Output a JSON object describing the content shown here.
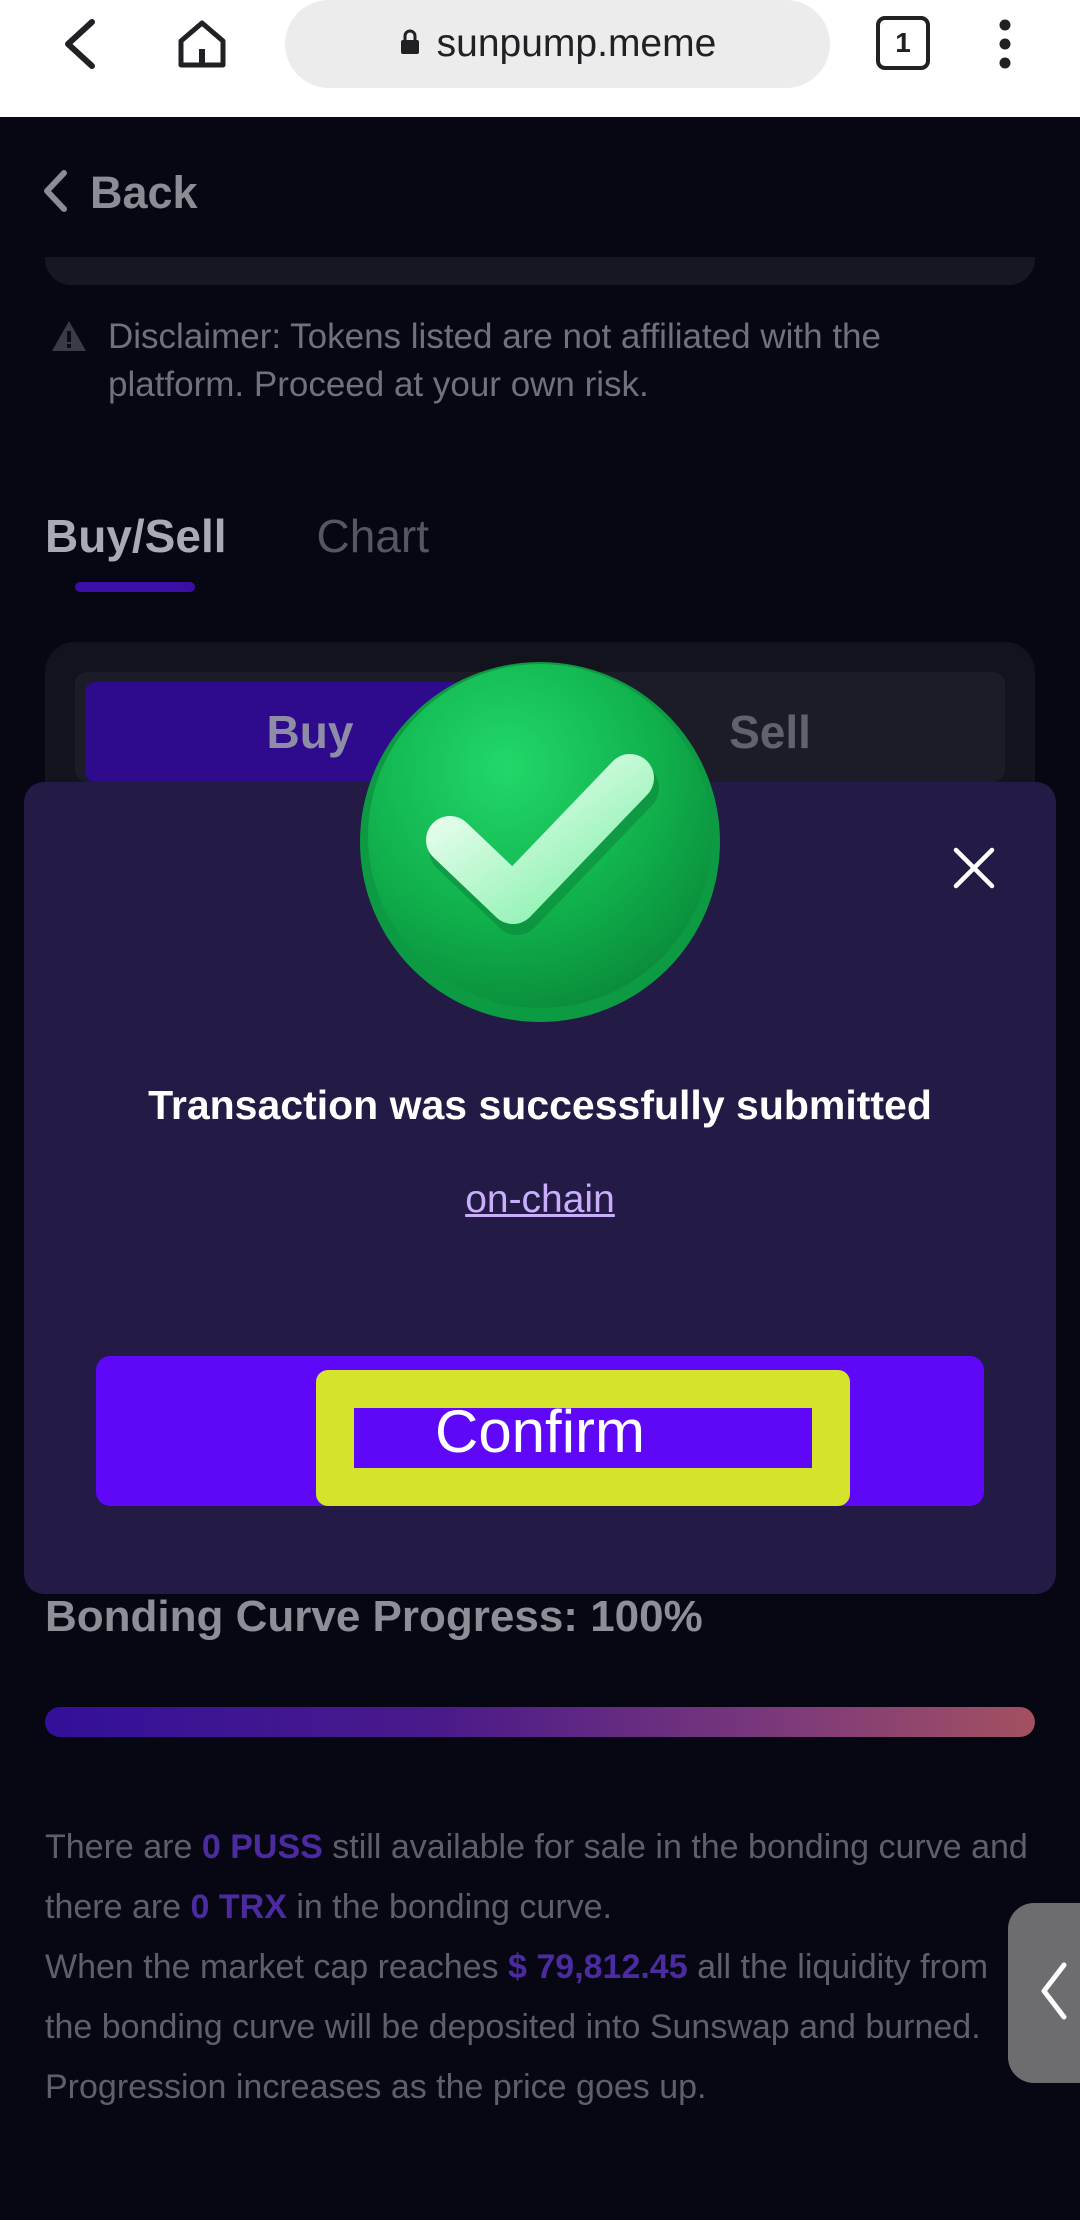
{
  "browser": {
    "url": "sunpump.meme",
    "tab_count": "1",
    "icons": [
      "back-arrow-icon",
      "home-icon",
      "lock-icon",
      "tabs-icon",
      "more-vert-icon"
    ]
  },
  "page": {
    "back_label": "Back",
    "disclaimer": "Disclaimer: Tokens listed are not affiliated with the platform. Proceed at your own risk.",
    "tabs": [
      {
        "label": "Buy/Sell",
        "active": true
      },
      {
        "label": "Chart",
        "active": false
      }
    ],
    "trade": {
      "buy_label": "Buy",
      "sell_label": "Sell"
    },
    "bonding": {
      "title": "Bonding Curve Progress: 100%",
      "progress": 1.0,
      "text_parts": {
        "p1": "There are ",
        "token_amount": "0 PUSS",
        "p2": " still available for sale in the bonding curve and there are ",
        "trx_amount": "0 TRX",
        "p3": " in the bonding curve.",
        "p4": "When the market cap reaches ",
        "market_cap": "$ 79,812.45",
        "p5": " all the liquidity from the bonding curve will be deposited into Sunswap and burned. Progression increases as the price goes up."
      }
    }
  },
  "modal": {
    "title": "Transaction was successfully submitted",
    "link_label": "on-chain",
    "confirm_label": "Confirm"
  },
  "colors": {
    "accent": "#5e08f7",
    "modal_bg": "#231a46",
    "highlight": "#d6e32b",
    "success_green": "#18c95b"
  }
}
